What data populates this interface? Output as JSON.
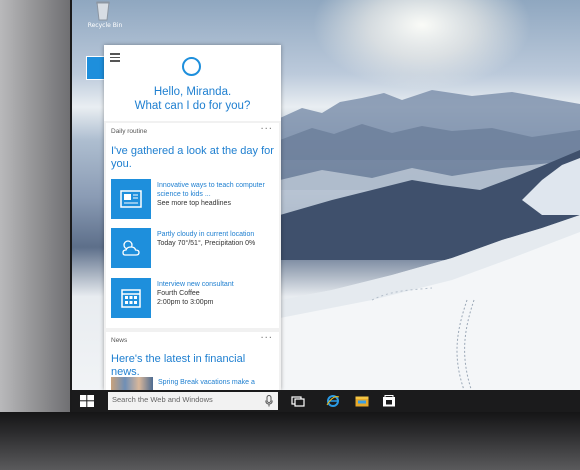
{
  "desktop": {
    "recycle_bin_label": "Recycle Bin"
  },
  "cortana": {
    "greeting_line1": "Hello, Miranda.",
    "greeting_line2": "What can I do for you?",
    "daily": {
      "label": "Daily routine",
      "more": "···",
      "headline": "I've gathered a look at the day for you.",
      "items": [
        {
          "title": "Innovative ways to teach computer science to kids ...",
          "subtitle": "See more top headlines",
          "icon": "news-icon"
        },
        {
          "title": "Partly cloudy in current location",
          "subtitle": "Today 70°/51°, Precipitation 0%",
          "icon": "weather-icon"
        },
        {
          "title": "Interview new consultant",
          "subtitle": "Fourth Coffee\n2:00pm to 3:00pm",
          "icon": "calendar-icon"
        }
      ]
    },
    "news": {
      "label": "News",
      "more": "···",
      "headline": "Here's the latest in financial news.",
      "item": "Spring Break vacations make a"
    }
  },
  "taskbar": {
    "search_placeholder": "Search the Web and Windows",
    "icons": [
      "windows-start-icon",
      "microphone-icon",
      "task-view-icon",
      "internet-explorer-icon",
      "file-explorer-icon",
      "store-icon"
    ]
  },
  "colors": {
    "accent": "#1e8fdc",
    "text_accent": "#1e7fd0",
    "taskbar": "#1b1b1c"
  }
}
